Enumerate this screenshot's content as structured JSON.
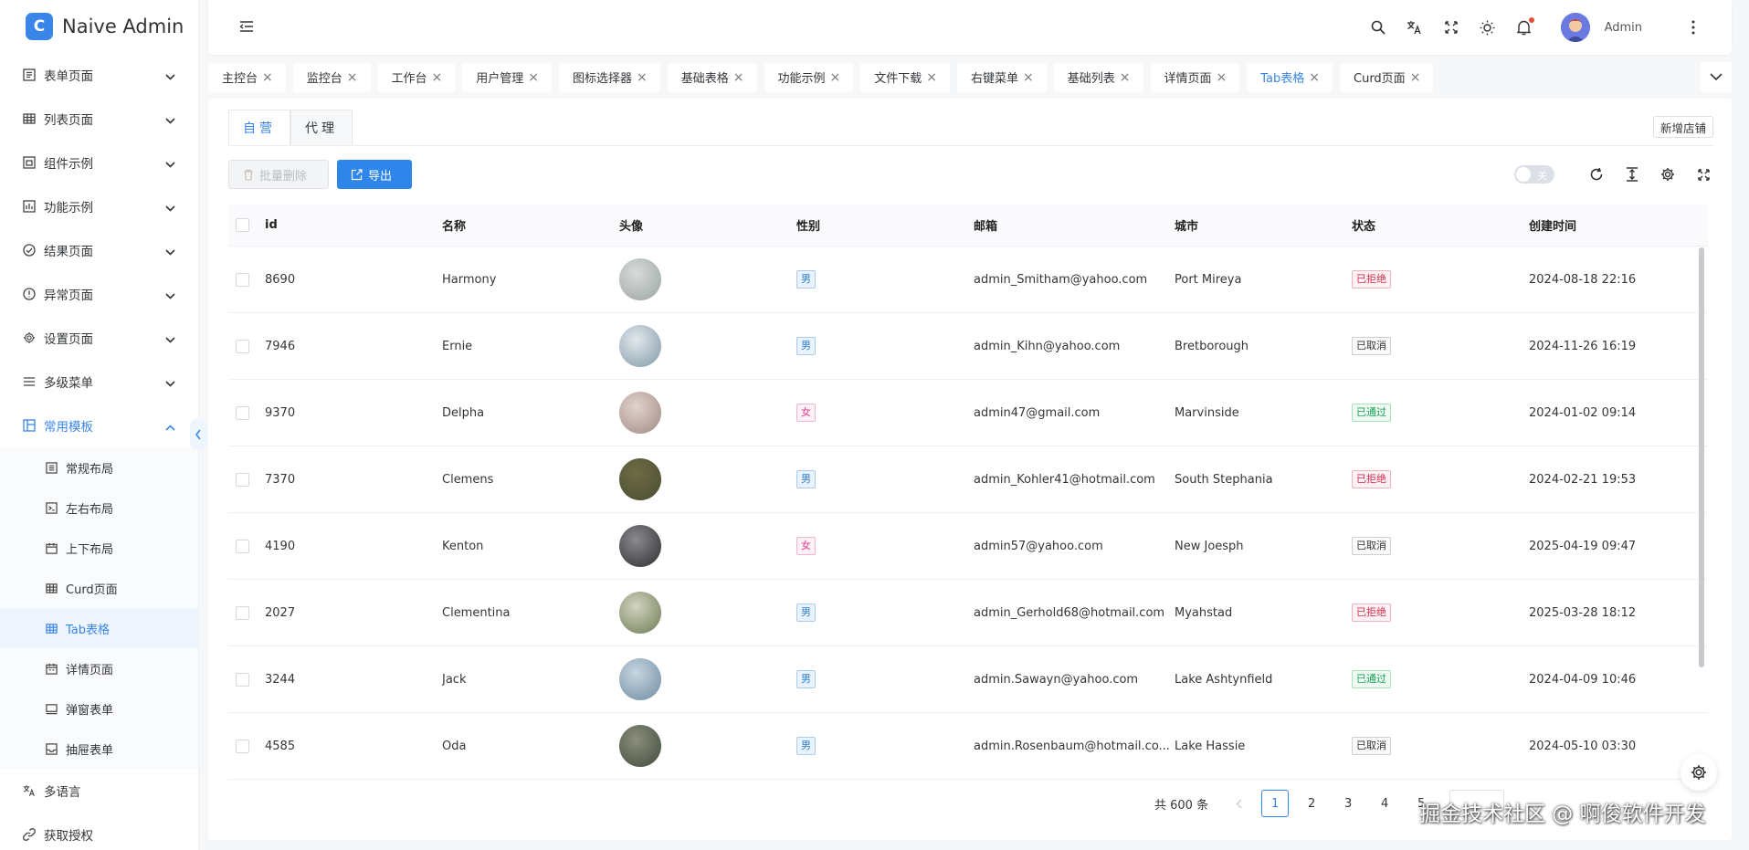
{
  "app": {
    "title": "Naive Admin",
    "logo_letter": "C"
  },
  "sidebar": {
    "items": [
      {
        "label": "表单页面",
        "icon": "form-icon"
      },
      {
        "label": "列表页面",
        "icon": "table-icon"
      },
      {
        "label": "组件示例",
        "icon": "component-icon"
      },
      {
        "label": "功能示例",
        "icon": "function-icon"
      },
      {
        "label": "结果页面",
        "icon": "check-circle-icon"
      },
      {
        "label": "异常页面",
        "icon": "alert-icon"
      },
      {
        "label": "设置页面",
        "icon": "gear-icon"
      },
      {
        "label": "多级菜单",
        "icon": "list-icon"
      },
      {
        "label": "常用模板",
        "icon": "template-icon"
      }
    ],
    "sub_items": [
      {
        "label": "常规布局"
      },
      {
        "label": "左右布局"
      },
      {
        "label": "上下布局"
      },
      {
        "label": "Curd页面"
      },
      {
        "label": "Tab表格"
      },
      {
        "label": "详情页面"
      },
      {
        "label": "弹窗表单"
      },
      {
        "label": "抽屉表单"
      }
    ],
    "bottom_items": [
      {
        "label": "多语言"
      },
      {
        "label": "获取授权"
      }
    ]
  },
  "header": {
    "username": "Admin"
  },
  "tabs": [
    {
      "label": "主控台"
    },
    {
      "label": "监控台"
    },
    {
      "label": "工作台"
    },
    {
      "label": "用户管理"
    },
    {
      "label": "图标选择器"
    },
    {
      "label": "基础表格"
    },
    {
      "label": "功能示例"
    },
    {
      "label": "文件下载"
    },
    {
      "label": "右键菜单"
    },
    {
      "label": "基础列表"
    },
    {
      "label": "详情页面"
    },
    {
      "label": "Tab表格"
    },
    {
      "label": "Curd页面"
    }
  ],
  "panel": {
    "seg_tabs": [
      "自营",
      "代理"
    ],
    "add_shop": "新增店铺",
    "batch_delete": "批量删除",
    "export": "导出",
    "switch_label": "关"
  },
  "table": {
    "columns": [
      "id",
      "名称",
      "头像",
      "性别",
      "邮箱",
      "城市",
      "状态",
      "创建时间"
    ],
    "rows": [
      {
        "id": "8690",
        "name": "Harmony",
        "sex": "男",
        "email": "admin_Smitham@yahoo.com",
        "city": "Port Mireya",
        "status": "已拒绝",
        "time": "2024-08-18 22:16"
      },
      {
        "id": "7946",
        "name": "Ernie",
        "sex": "男",
        "email": "admin_Kihn@yahoo.com",
        "city": "Bretborough",
        "status": "已取消",
        "time": "2024-11-26 16:19"
      },
      {
        "id": "9370",
        "name": "Delpha",
        "sex": "女",
        "email": "admin47@gmail.com",
        "city": "Marvinside",
        "status": "已通过",
        "time": "2024-01-02 09:14"
      },
      {
        "id": "7370",
        "name": "Clemens",
        "sex": "男",
        "email": "admin_Kohler41@hotmail.com",
        "city": "South Stephania",
        "status": "已拒绝",
        "time": "2024-02-21 19:53"
      },
      {
        "id": "4190",
        "name": "Kenton",
        "sex": "女",
        "email": "admin57@yahoo.com",
        "city": "New Joesph",
        "status": "已取消",
        "time": "2025-04-19 09:47"
      },
      {
        "id": "2027",
        "name": "Clementina",
        "sex": "男",
        "email": "admin_Gerhold68@hotmail.com",
        "city": "Myahstad",
        "status": "已拒绝",
        "time": "2025-03-28 18:12"
      },
      {
        "id": "3244",
        "name": "Jack",
        "sex": "男",
        "email": "admin.Sawayn@yahoo.com",
        "city": "Lake Ashtynfield",
        "status": "已通过",
        "time": "2024-04-09 10:46"
      },
      {
        "id": "4585",
        "name": "Oda",
        "sex": "男",
        "email": "admin.Rosenbaum@hotmail.co...",
        "city": "Lake Hassie",
        "status": "已取消",
        "time": "2024-05-10 03:30"
      }
    ]
  },
  "pagination": {
    "total": "共 600 条",
    "pages": [
      "1",
      "2",
      "3",
      "4",
      "5"
    ],
    "current": "1"
  },
  "watermark": "掘金技术社区 @ 啊俊软件开发",
  "colors": {
    "accent": "#3a86e8",
    "rejected": "#d03050",
    "approved": "#18a058"
  }
}
